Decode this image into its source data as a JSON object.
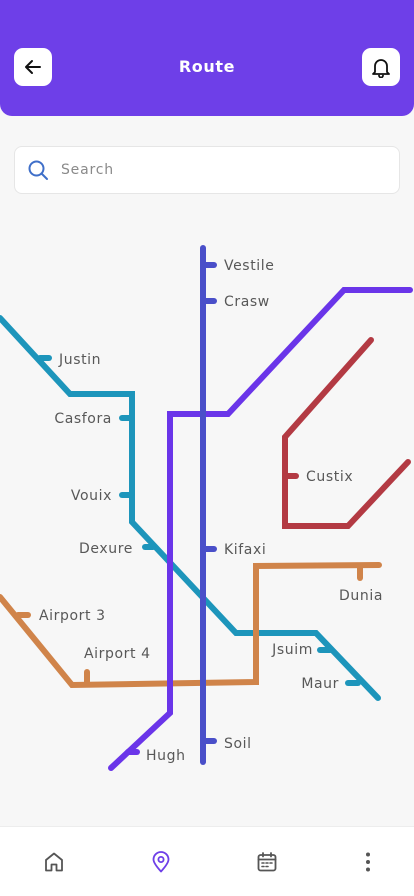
{
  "header": {
    "title": "Route",
    "back_icon": "arrow-left-icon",
    "notification_icon": "bell-icon",
    "background_color": "#6e3fe8"
  },
  "search": {
    "placeholder": "Search",
    "value": "",
    "icon": "search-icon"
  },
  "map": {
    "lines": {
      "purple": "#6a35e9",
      "blue": "#4a4fc9",
      "teal": "#1d95bb",
      "red": "#b33a43",
      "orange": "#d0844a"
    },
    "stations": {
      "vestile": "Vestile",
      "crasw": "Crasw",
      "justin": "Justin",
      "casfora": "Casfora",
      "custix": "Custix",
      "vouix": "Vouix",
      "dexure": "Dexure",
      "kifaxi": "Kifaxi",
      "dunia": "Dunia",
      "airport3": "Airport 3",
      "airport4": "Airport 4",
      "jsuim": "Jsuim",
      "maur": "Maur",
      "soil": "Soil",
      "hugh": "Hugh"
    }
  },
  "bottom_nav": {
    "items": [
      {
        "icon": "home-icon",
        "active": false
      },
      {
        "icon": "map-pin-icon",
        "active": true
      },
      {
        "icon": "calendar-icon",
        "active": false
      },
      {
        "icon": "more-vertical-icon",
        "active": false
      }
    ],
    "active_color": "#6e3fe8",
    "inactive_color": "#555555"
  }
}
